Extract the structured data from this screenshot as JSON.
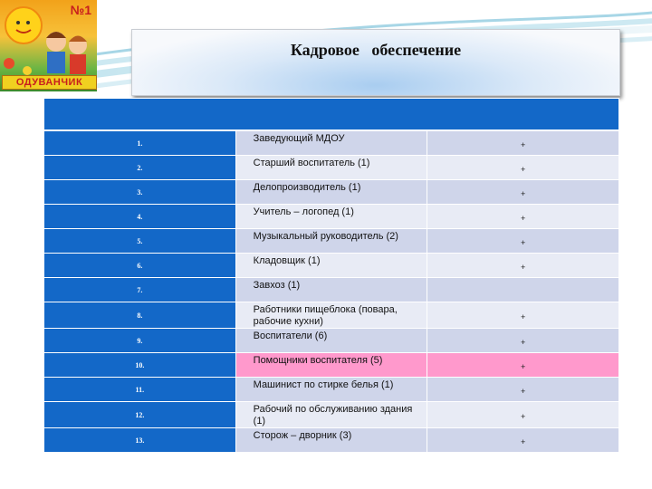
{
  "logo": {
    "number": "№1",
    "name": "ОДУВАНЧИК"
  },
  "title": "Кадровое   обеспечение",
  "table": {
    "rows": [
      {
        "num": "1.",
        "name": "Заведующий МДОУ",
        "mark": "+"
      },
      {
        "num": "2.",
        "name": "Старший воспитатель  (1)",
        "mark": "+"
      },
      {
        "num": "3.",
        "name": "Делопроизводитель (1)",
        "mark": "+"
      },
      {
        "num": "4.",
        "name": "Учитель – логопед (1)",
        "mark": "+"
      },
      {
        "num": "5.",
        "name": "Музыкальный руководитель  (2)",
        "mark": "+"
      },
      {
        "num": "6.",
        "name": "Кладовщик (1)",
        "mark": "+"
      },
      {
        "num": "7.",
        "name": "Завхоз (1)",
        "mark": ""
      },
      {
        "num": "8.",
        "name": "Работники пищеблока (повара, рабочие кухни)",
        "mark": "+"
      },
      {
        "num": "9.",
        "name": "Воспитатели (6)",
        "mark": "+"
      },
      {
        "num": "10.",
        "name": "Помощники воспитателя (5)",
        "mark": "+"
      },
      {
        "num": "11.",
        "name": "Машинист по   стирке белья (1)",
        "mark": "+"
      },
      {
        "num": "12.",
        "name": "Рабочий по обслуживанию здания (1)",
        "mark": "+"
      },
      {
        "num": "13.",
        "name": "Сторож – дворник (3)",
        "mark": "+"
      }
    ]
  },
  "colors": {
    "header_blue": "#1368c8",
    "row_dark": "#cfd5ea",
    "row_light": "#e8ebf5",
    "highlight_pink": "#ff99cc"
  }
}
